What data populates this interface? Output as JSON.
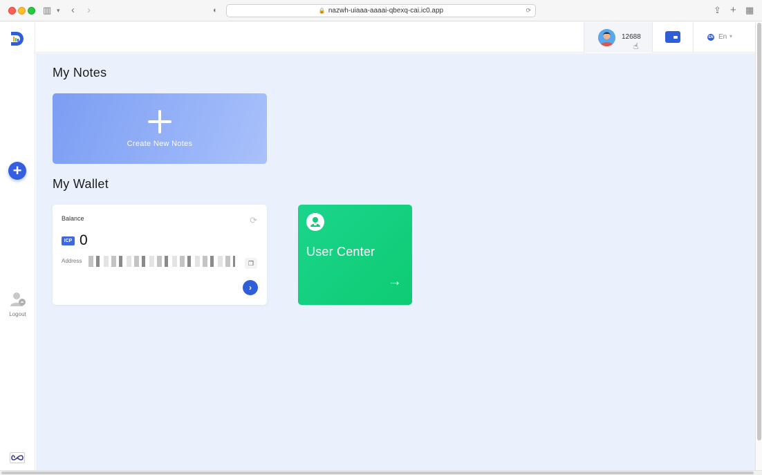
{
  "browser": {
    "url": "nazwh-uiaaa-aaaai-qbexq-cai.ic0.app"
  },
  "sidebar": {
    "logout_label": "Logout"
  },
  "header": {
    "user_id": "12688",
    "language": "En",
    "language_badge": "EN"
  },
  "main": {
    "notes_title": "My Notes",
    "create_label": "Create New Notes",
    "wallet_title": "My Wallet",
    "balance": {
      "label": "Balance",
      "currency": "ICP",
      "value": "0",
      "address_label": "Address"
    },
    "user_center_label": "User Center"
  },
  "colors": {
    "accent": "#3460e0",
    "user_center": "#14d07f",
    "background": "#eaf0fc"
  }
}
